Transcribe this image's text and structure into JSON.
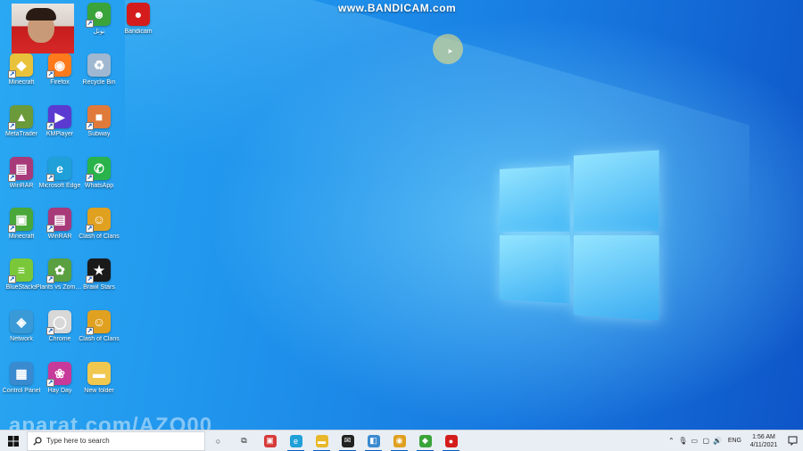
{
  "watermark": "www.BANDICAM.com",
  "overlay_text": "aparat.com/AZO00",
  "desktop_icons": [
    {
      "label": "تونل",
      "glyph": "☻",
      "color": "#3aa43a",
      "shortcut": true
    },
    {
      "label": "Bandicam",
      "glyph": "●",
      "color": "#d51c1c",
      "shortcut": false
    },
    {
      "label": "Minecraft",
      "glyph": "◆",
      "color": "#e8c23a",
      "shortcut": true
    },
    {
      "label": "Firefox",
      "glyph": "◉",
      "color": "#ff7a1c",
      "shortcut": true
    },
    {
      "label": "Recycle Bin",
      "glyph": "♻",
      "color": "#9fb7d0",
      "shortcut": false
    },
    {
      "label": "MetaTrader",
      "glyph": "▲",
      "color": "#6a9a3a",
      "shortcut": true
    },
    {
      "label": "KMPlayer",
      "glyph": "▶",
      "color": "#5a3ad0",
      "shortcut": true
    },
    {
      "label": "Subway",
      "glyph": "■",
      "color": "#e07a3a",
      "shortcut": true
    },
    {
      "label": "WinRAR",
      "glyph": "▤",
      "color": "#a83a7a",
      "shortcut": true
    },
    {
      "label": "Microsoft Edge",
      "glyph": "e",
      "color": "#1fa0d8",
      "shortcut": true
    },
    {
      "label": "WhatsApp",
      "glyph": "✆",
      "color": "#29b34a",
      "shortcut": true
    },
    {
      "label": "Minecraft",
      "glyph": "▣",
      "color": "#4aa83a",
      "shortcut": true
    },
    {
      "label": "WinRAR",
      "glyph": "▤",
      "color": "#a83a7a",
      "shortcut": true
    },
    {
      "label": "Clash of Clans",
      "glyph": "☺",
      "color": "#e0a020",
      "shortcut": true
    },
    {
      "label": "BlueStacks",
      "glyph": "≡",
      "color": "#7ac83a",
      "shortcut": true
    },
    {
      "label": "Plants vs Zombies",
      "glyph": "✿",
      "color": "#5aa040",
      "shortcut": true
    },
    {
      "label": "Brawl Stars",
      "glyph": "★",
      "color": "#1a1a1a",
      "shortcut": true
    },
    {
      "label": "Network",
      "glyph": "◈",
      "color": "#3a9ad8",
      "shortcut": false
    },
    {
      "label": "Chrome",
      "glyph": "◯",
      "color": "#d8d8d8",
      "shortcut": true
    },
    {
      "label": "Clash of Clans",
      "glyph": "☺",
      "color": "#e0a020",
      "shortcut": true
    },
    {
      "label": "Control Panel",
      "glyph": "▦",
      "color": "#3a8ad0",
      "shortcut": false
    },
    {
      "label": "Hay Day",
      "glyph": "❀",
      "color": "#c83a9a",
      "shortcut": true
    },
    {
      "label": "New folder",
      "glyph": "▬",
      "color": "#f0c850",
      "shortcut": false
    }
  ],
  "taskbar": {
    "search_placeholder": "Type here to search",
    "apps": [
      {
        "name": "Cortana",
        "glyph": "○",
        "color": "#222"
      },
      {
        "name": "Task View",
        "glyph": "⧉",
        "color": "#222"
      },
      {
        "name": "Photo app",
        "glyph": "▣",
        "color": "#d63a3a"
      },
      {
        "name": "Microsoft Edge",
        "glyph": "e",
        "color": "#1fa0d8"
      },
      {
        "name": "File Explorer",
        "glyph": "▬",
        "color": "#e8b82a"
      },
      {
        "name": "Mail",
        "glyph": "✉",
        "color": "#222"
      },
      {
        "name": "Store",
        "glyph": "◧",
        "color": "#3a8ad0"
      },
      {
        "name": "Chrome",
        "glyph": "◉",
        "color": "#e0a020"
      },
      {
        "name": "Minecraft",
        "glyph": "◆",
        "color": "#3aa43a"
      },
      {
        "name": "Bandicam",
        "glyph": "●",
        "color": "#d51c1c"
      }
    ],
    "language": "ENG",
    "time": "1:56 AM",
    "date": "4/11/2021"
  }
}
